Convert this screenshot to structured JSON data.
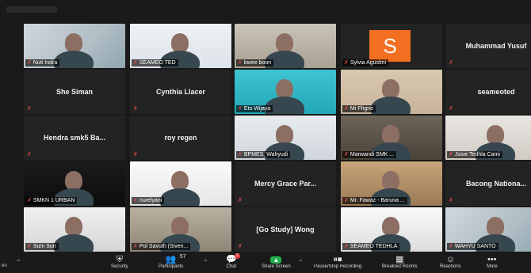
{
  "tiles": [
    {
      "name": "Nuti Indra",
      "type": "video",
      "row": 0,
      "col": 0
    },
    {
      "name": "SEAMEO TED",
      "type": "video",
      "row": 0,
      "col": 1
    },
    {
      "name": "bwee boon",
      "type": "video",
      "row": 0,
      "col": 2
    },
    {
      "name": "Sylvia Agustini",
      "type": "avatar",
      "initial": "S",
      "row": 0,
      "col": 3
    },
    {
      "name": "Muhammad Yusuf",
      "type": "name",
      "row": 0,
      "col": 4
    },
    {
      "name": "She Siman",
      "type": "name",
      "row": 1,
      "col": 0
    },
    {
      "name": "Cynthia Llacer",
      "type": "name",
      "row": 1,
      "col": 1
    },
    {
      "name": "Eto Wijaya",
      "type": "video",
      "row": 1,
      "col": 2
    },
    {
      "name": "Mi Fhgne",
      "type": "video",
      "row": 1,
      "col": 3
    },
    {
      "name": "seameoted",
      "type": "name",
      "row": 1,
      "col": 4
    },
    {
      "name": "Hendra smk5 Ba...",
      "type": "name",
      "row": 2,
      "col": 0
    },
    {
      "name": "roy regen",
      "type": "name",
      "row": 2,
      "col": 1
    },
    {
      "name": "BPMES_Wahyudi",
      "type": "video",
      "row": 2,
      "col": 2
    },
    {
      "name": "Marwandi SMK ...",
      "type": "video",
      "row": 2,
      "col": 3
    },
    {
      "name": "Josie Tedhla Cami",
      "type": "video",
      "row": 2,
      "col": 4
    },
    {
      "name": "SMKN 1 URBAN",
      "type": "video",
      "row": 3,
      "col": 0
    },
    {
      "name": "nurelyani",
      "type": "video",
      "row": 3,
      "col": 1
    },
    {
      "name": "Mercy Grace Par...",
      "type": "name",
      "row": 3,
      "col": 2
    },
    {
      "name": "Mr. Fawaz - Baruna ...",
      "type": "video",
      "row": 3,
      "col": 3
    },
    {
      "name": "Bacong Nationa...",
      "type": "name",
      "row": 3,
      "col": 4
    },
    {
      "name": "Sum Sun",
      "type": "video",
      "row": 4,
      "col": 0
    },
    {
      "name": "Pol Savuth (Siven...",
      "type": "video",
      "row": 4,
      "col": 1
    },
    {
      "name": "[Go Study] Wong",
      "type": "name",
      "row": 4,
      "col": 2
    },
    {
      "name": "SEAMEO TEDHLA",
      "type": "video",
      "row": 4,
      "col": 3
    },
    {
      "name": "WAHYU SANTO",
      "type": "video",
      "row": 4,
      "col": 4
    }
  ],
  "toolbar": {
    "participants_count": "57",
    "chat_badge": "2",
    "buttons": [
      {
        "key": "security",
        "label": "Security",
        "icon": "shield-icon"
      },
      {
        "key": "participants",
        "label": "Participants",
        "icon": "people-icon"
      },
      {
        "key": "chat",
        "label": "Chat",
        "icon": "chat-icon"
      },
      {
        "key": "share",
        "label": "Share Screen",
        "icon": "share-screen-icon"
      },
      {
        "key": "pause",
        "label": "Pause/Stop Recording",
        "icon": "pause-icon"
      },
      {
        "key": "breakout",
        "label": "Breakout Rooms",
        "icon": "breakout-icon"
      },
      {
        "key": "reactions",
        "label": "Reactions",
        "icon": "reactions-icon"
      },
      {
        "key": "more",
        "label": "More",
        "icon": "more-icon"
      }
    ],
    "left_label": "ео"
  },
  "colors": {
    "muted_mic": "#e14b4b",
    "share": "#22b14c",
    "chat_badge": "#e94040",
    "avatar": "#f36f21"
  }
}
